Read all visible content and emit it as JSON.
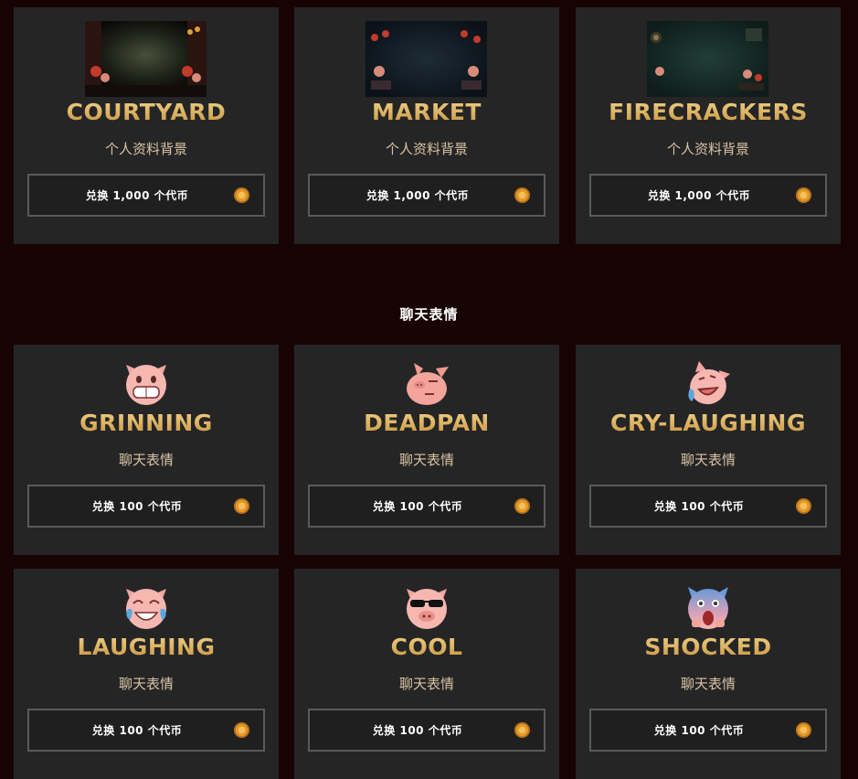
{
  "profile_backgrounds": [
    {
      "title": "COURTYARD",
      "subtitle": "个人资料背景",
      "button_label": "兑换 1,000 个代币",
      "icon": "coin-icon",
      "thumb_icon": "courtyard-thumbnail"
    },
    {
      "title": "MARKET",
      "subtitle": "个人资料背景",
      "button_label": "兑换 1,000 个代币",
      "icon": "coin-icon",
      "thumb_icon": "market-thumbnail"
    },
    {
      "title": "FIRECRACKERS",
      "subtitle": "个人资料背景",
      "button_label": "兑换 1,000 个代币",
      "icon": "coin-icon",
      "thumb_icon": "firecrackers-thumbnail"
    }
  ],
  "chat_section": {
    "heading": "聊天表情"
  },
  "emoticons": [
    {
      "title": "GRINNING",
      "subtitle": "聊天表情",
      "button_label": "兑换 100 个代币",
      "icon": "grinning-pig-icon"
    },
    {
      "title": "DEADPAN",
      "subtitle": "聊天表情",
      "button_label": "兑换 100 个代币",
      "icon": "deadpan-pig-icon"
    },
    {
      "title": "CRY-LAUGHING",
      "subtitle": "聊天表情",
      "button_label": "兑换 100 个代币",
      "icon": "cry-laughing-pig-icon"
    },
    {
      "title": "LAUGHING",
      "subtitle": "聊天表情",
      "button_label": "兑换 100 个代币",
      "icon": "laughing-pig-icon"
    },
    {
      "title": "COOL",
      "subtitle": "聊天表情",
      "button_label": "兑换 100 个代币",
      "icon": "cool-pig-icon"
    },
    {
      "title": "SHOCKED",
      "subtitle": "聊天表情",
      "button_label": "兑换 100 个代币",
      "icon": "shocked-pig-icon"
    }
  ],
  "colors": {
    "page_bg": "#170304",
    "card_bg": "#252526",
    "title_gold": "#e2b862",
    "subtitle": "#d8c3a4",
    "button_border": "#5a5a5a"
  }
}
